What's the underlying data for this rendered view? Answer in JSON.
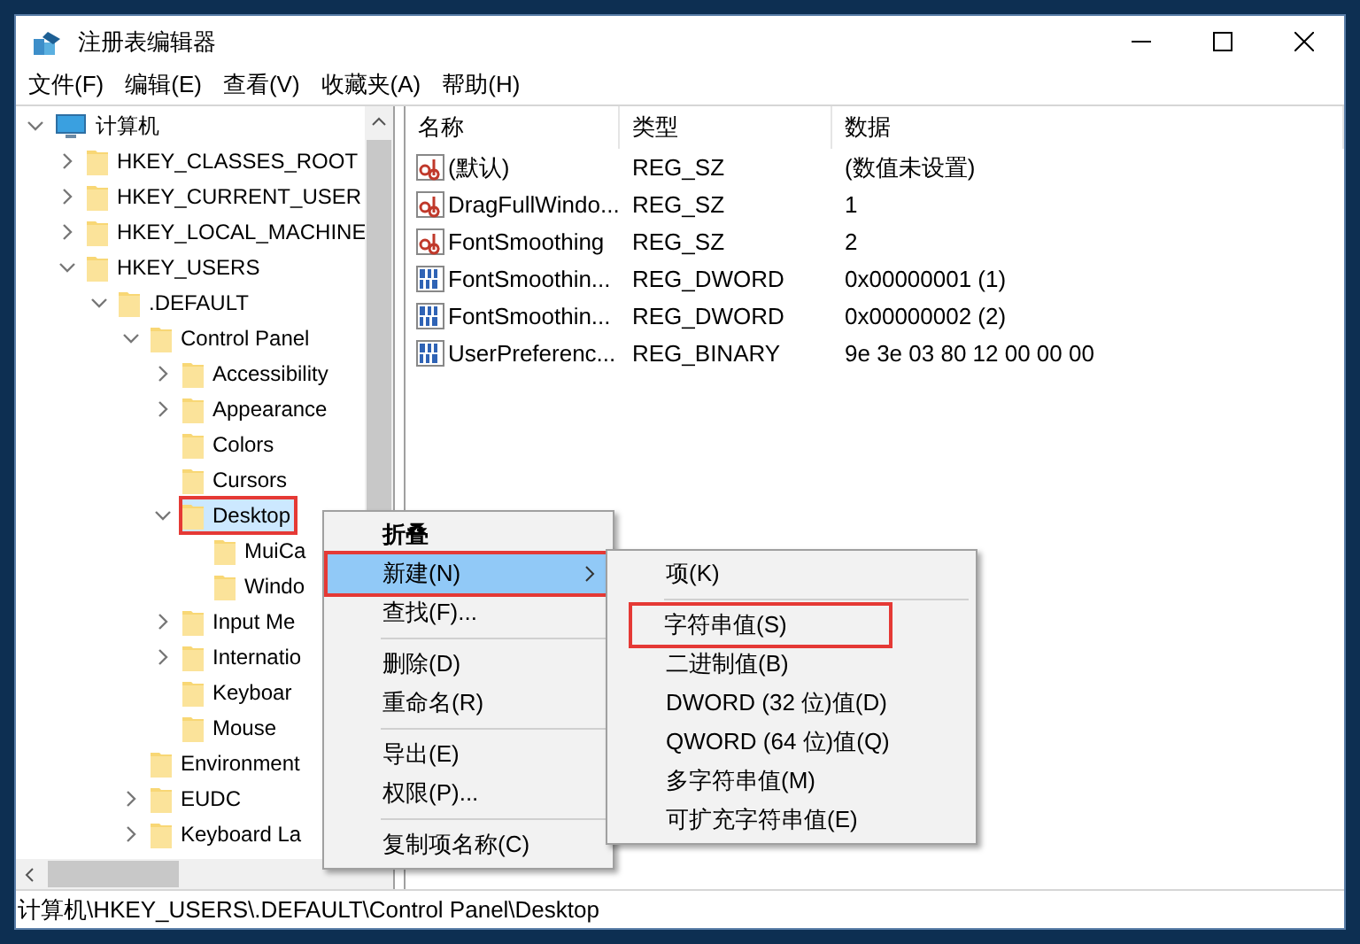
{
  "window": {
    "title": "注册表编辑器"
  },
  "menu_bar": [
    "文件(F)",
    "编辑(E)",
    "查看(V)",
    "收藏夹(A)",
    "帮助(H)"
  ],
  "tree": {
    "label": "计算机",
    "expandable": true,
    "expanded": true,
    "selected": false,
    "marked": false,
    "children": [
      {
        "label": "HKEY_CLASSES_ROOT",
        "expandable": true,
        "expanded": false,
        "selected": false,
        "marked": false
      },
      {
        "label": "HKEY_CURRENT_USER",
        "expandable": true,
        "expanded": false,
        "selected": false,
        "marked": false
      },
      {
        "label": "HKEY_LOCAL_MACHINE",
        "expandable": true,
        "expanded": false,
        "selected": false,
        "marked": false
      },
      {
        "label": "HKEY_USERS",
        "expandable": true,
        "expanded": true,
        "selected": false,
        "marked": false,
        "children": [
          {
            "label": ".DEFAULT",
            "expandable": true,
            "expanded": true,
            "selected": false,
            "marked": false,
            "children": [
              {
                "label": "Control Panel",
                "expandable": true,
                "expanded": true,
                "selected": false,
                "marked": false,
                "children": [
                  {
                    "label": "Accessibility",
                    "expandable": true,
                    "expanded": false,
                    "selected": false,
                    "marked": false
                  },
                  {
                    "label": "Appearance",
                    "expandable": true,
                    "expanded": false,
                    "selected": false,
                    "marked": false
                  },
                  {
                    "label": "Colors",
                    "expandable": false,
                    "selected": false,
                    "marked": false
                  },
                  {
                    "label": "Cursors",
                    "expandable": false,
                    "selected": false,
                    "marked": false
                  },
                  {
                    "label": "Desktop",
                    "expandable": true,
                    "expanded": true,
                    "selected": true,
                    "marked": true,
                    "children": [
                      {
                        "label": "MuiCa",
                        "expandable": false,
                        "selected": false,
                        "marked": false
                      },
                      {
                        "label": "Windo",
                        "expandable": false,
                        "selected": false,
                        "marked": false
                      }
                    ]
                  },
                  {
                    "label": "Input Me",
                    "expandable": true,
                    "expanded": false,
                    "selected": false,
                    "marked": false
                  },
                  {
                    "label": "Internatio",
                    "expandable": true,
                    "expanded": false,
                    "selected": false,
                    "marked": false
                  },
                  {
                    "label": "Keyboar",
                    "expandable": false,
                    "selected": false,
                    "marked": false
                  },
                  {
                    "label": "Mouse",
                    "expandable": false,
                    "selected": false,
                    "marked": false
                  }
                ]
              },
              {
                "label": "Environment",
                "expandable": false,
                "selected": false,
                "marked": false
              },
              {
                "label": "EUDC",
                "expandable": true,
                "expanded": false,
                "selected": false,
                "marked": false
              },
              {
                "label": "Keyboard La",
                "expandable": true,
                "expanded": false,
                "selected": false,
                "marked": false
              }
            ]
          }
        ]
      }
    ]
  },
  "values": {
    "columns": [
      "名称",
      "类型",
      "数据"
    ],
    "rows": [
      {
        "kind": "string",
        "name": "(默认)",
        "type": "REG_SZ",
        "data": "(数值未设置)"
      },
      {
        "kind": "string",
        "name": "DragFullWindo...",
        "type": "REG_SZ",
        "data": "1"
      },
      {
        "kind": "string",
        "name": "FontSmoothing",
        "type": "REG_SZ",
        "data": "2"
      },
      {
        "kind": "binary",
        "name": "FontSmoothin...",
        "type": "REG_DWORD",
        "data": "0x00000001 (1)"
      },
      {
        "kind": "binary",
        "name": "FontSmoothin...",
        "type": "REG_DWORD",
        "data": "0x00000002 (2)"
      },
      {
        "kind": "binary",
        "name": "UserPreferenc...",
        "type": "REG_BINARY",
        "data": "9e 3e 03 80 12 00 00 00"
      }
    ]
  },
  "context_menu": [
    {
      "kind": "item",
      "label": "折叠",
      "default": true,
      "selected": false,
      "marked": false,
      "submenu": false
    },
    {
      "kind": "item",
      "label": "新建(N)",
      "default": false,
      "selected": true,
      "marked": true,
      "submenu": true
    },
    {
      "kind": "item",
      "label": "查找(F)...",
      "default": false,
      "selected": false,
      "marked": false,
      "submenu": false
    },
    {
      "kind": "separator"
    },
    {
      "kind": "item",
      "label": "删除(D)",
      "default": false,
      "selected": false,
      "marked": false,
      "submenu": false
    },
    {
      "kind": "item",
      "label": "重命名(R)",
      "default": false,
      "selected": false,
      "marked": false,
      "submenu": false
    },
    {
      "kind": "separator"
    },
    {
      "kind": "item",
      "label": "导出(E)",
      "default": false,
      "selected": false,
      "marked": false,
      "submenu": false
    },
    {
      "kind": "item",
      "label": "权限(P)...",
      "default": false,
      "selected": false,
      "marked": false,
      "submenu": false
    },
    {
      "kind": "separator"
    },
    {
      "kind": "item",
      "label": "复制项名称(C)",
      "default": false,
      "selected": false,
      "marked": false,
      "submenu": false
    }
  ],
  "submenu": [
    {
      "kind": "item",
      "label": "项(K)",
      "marked": false
    },
    {
      "kind": "separator"
    },
    {
      "kind": "item",
      "label": "字符串值(S)",
      "marked": true
    },
    {
      "kind": "item",
      "label": "二进制值(B)",
      "marked": false
    },
    {
      "kind": "item",
      "label": "DWORD (32 位)值(D)",
      "marked": false
    },
    {
      "kind": "item",
      "label": "QWORD (64 位)值(Q)",
      "marked": false
    },
    {
      "kind": "item",
      "label": "多字符串值(M)",
      "marked": false
    },
    {
      "kind": "item",
      "label": "可扩充字符串值(E)",
      "marked": false
    }
  ],
  "status_bar": "计算机\\HKEY_USERS\\.DEFAULT\\Control Panel\\Desktop"
}
